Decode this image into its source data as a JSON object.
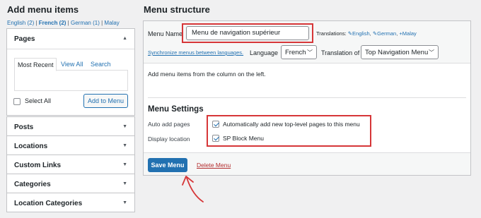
{
  "left": {
    "heading": "Add menu items",
    "languages": [
      {
        "label": "English (2)",
        "current": false
      },
      {
        "label": "French (2)",
        "current": true
      },
      {
        "label": "German (1)",
        "current": false
      },
      {
        "label": "Malay",
        "current": false
      }
    ],
    "pages": {
      "title": "Pages",
      "tabs": [
        "Most Recent",
        "View All",
        "Search"
      ],
      "select_all_label": "Select All",
      "add_button": "Add to Menu"
    },
    "sections": [
      "Posts",
      "Locations",
      "Custom Links",
      "Categories",
      "Location Categories"
    ]
  },
  "right": {
    "heading": "Menu structure",
    "menu_name_label": "Menu Name",
    "menu_name_value": "Menu de navigation supérieur",
    "translations_label": "Translations:",
    "translations": [
      {
        "label": "English",
        "icon": "pencil-icon"
      },
      {
        "label": "German",
        "icon": "pencil-icon"
      },
      {
        "label": "Malay",
        "icon": "plus-icon"
      }
    ],
    "sync_link": "Synchronize menus between languages.",
    "language_label": "Language",
    "language_value": "French",
    "translation_of_label": "Translation of",
    "translation_of_value": "Top Navigation Menu",
    "hint": "Add menu items from the column on the left.",
    "settings_title": "Menu Settings",
    "auto_add_label": "Auto add pages",
    "auto_add_option": "Automatically add new top-level pages to this menu",
    "auto_add_checked": true,
    "display_location_label": "Display location",
    "display_location_option": "SP Block Menu",
    "display_location_checked": true,
    "save_button": "Save Menu",
    "delete_link": "Delete Menu"
  },
  "colors": {
    "accent": "#2271b1",
    "highlight": "#d63638",
    "danger": "#b32d2e"
  }
}
